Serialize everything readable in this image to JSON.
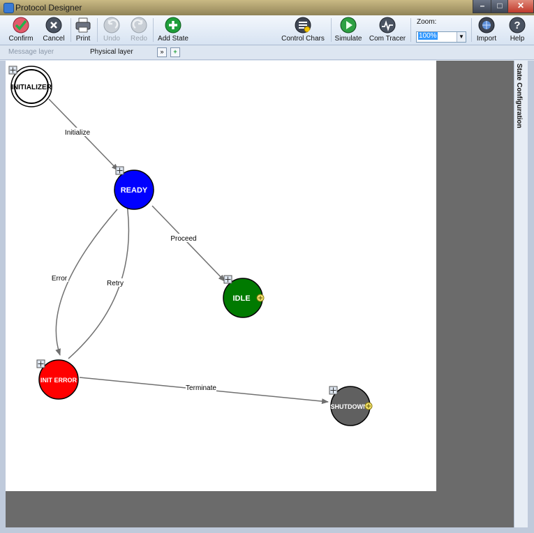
{
  "window": {
    "title": "Protocol Designer"
  },
  "toolbar": {
    "confirm": "Confirm",
    "cancel": "Cancel",
    "print": "Print",
    "undo": "Undo",
    "redo": "Redo",
    "add_state": "Add State",
    "control_chars": "Control Chars",
    "simulate": "Simulate",
    "com_tracer": "Com Tracer",
    "zoom_label": "Zoom:",
    "zoom_value": "100%",
    "import": "Import",
    "help": "Help"
  },
  "tabs": {
    "message_layer": "Message layer",
    "physical_layer": "Physical layer"
  },
  "side_panel": {
    "title": "State Configuration"
  },
  "diagram": {
    "states": {
      "initializer": {
        "label": "INITIALIZER",
        "color": "#ffffff"
      },
      "ready": {
        "label": "READY",
        "color": "#0000ff"
      },
      "idle": {
        "label": "IDLE",
        "color": "#007a00"
      },
      "init_error": {
        "label": "INIT ERROR",
        "color": "#ff0000"
      },
      "shutdown": {
        "label": "SHUTDOWN",
        "color": "#606060"
      }
    },
    "transitions": {
      "initialize": "Initialize",
      "proceed": "Proceed",
      "error": "Error",
      "retry": "Retry",
      "terminate": "Terminate"
    }
  }
}
